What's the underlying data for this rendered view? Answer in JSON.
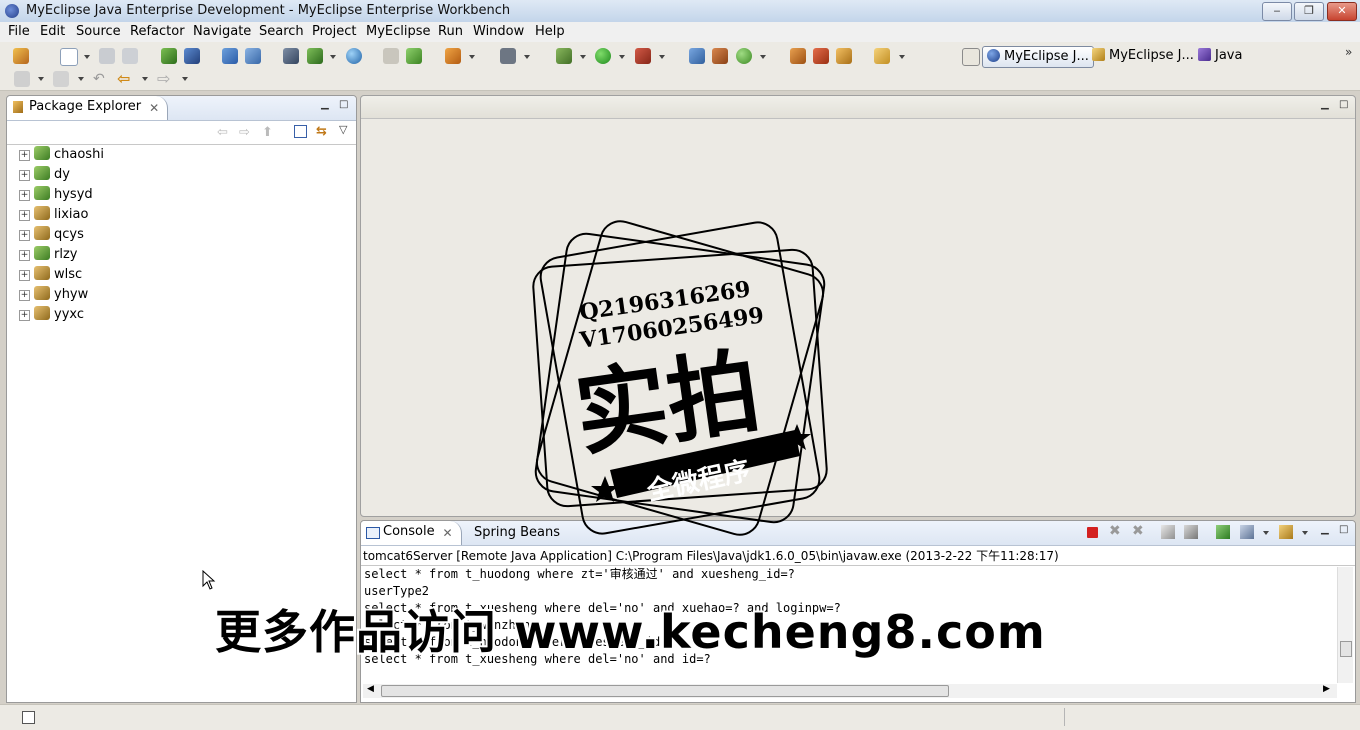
{
  "window": {
    "title": "MyEclipse Java Enterprise Development - MyEclipse Enterprise Workbench"
  },
  "menu": [
    "File",
    "Edit",
    "Source",
    "Refactor",
    "Navigate",
    "Search",
    "Project",
    "MyEclipse",
    "Run",
    "Window",
    "Help"
  ],
  "perspectives": {
    "active": "MyEclipse J...",
    "second": "MyEclipse J...",
    "third": "Java"
  },
  "package_explorer": {
    "tab_label": "Package Explorer",
    "projects": [
      "chaoshi",
      "dy",
      "hysyd",
      "lixiao",
      "qcys",
      "rlzy",
      "wlsc",
      "yhyw",
      "yyxc"
    ]
  },
  "console": {
    "tab_label": "Console",
    "second_tab_label": "Spring Beans",
    "header": "tomcat6Server [Remote Java Application] C:\\Program Files\\Java\\jdk1.6.0_05\\bin\\javaw.exe (2013-2-22 下午11:28:17)",
    "lines": [
      "select * from t_huodong where zt='审核通过' and xuesheng_id=?",
      "userType2",
      "select * from t_xuesheng where del='no' and xuehao=? and loginpw=?",
      "select * from t_wenzhang",
      "select * from t_huodong where xuesheng_id",
      "select * from t_xuesheng where del='no' and id=?"
    ]
  },
  "watermark": {
    "line1": "Q2196316269",
    "line2": "V17060256499",
    "big": "实拍",
    "banner": "全微程序",
    "overlay": "更多作品访问 www.kecheng8.com"
  }
}
